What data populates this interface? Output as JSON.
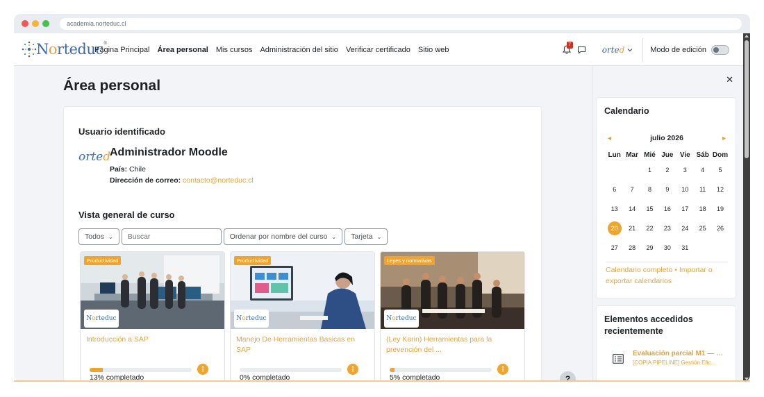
{
  "browser": {
    "url": "academia.norteduc.cl"
  },
  "navbar": {
    "logo_text_pre": "N",
    "logo_text_o": "o",
    "logo_text_post": "rteduc",
    "logo_reg": "®",
    "links": [
      {
        "label": "Página Principal",
        "active": false
      },
      {
        "label": "Área personal",
        "active": true
      },
      {
        "label": "Mis cursos",
        "active": false
      },
      {
        "label": "Administración del sitio",
        "active": false
      },
      {
        "label": "Verificar certificado",
        "active": false
      },
      {
        "label": "Sitio web",
        "active": false
      }
    ],
    "notification_count": "7",
    "user_logo_pre": "orte",
    "user_logo_o": "d",
    "edit_mode_label": "Modo de edición"
  },
  "page": {
    "title": "Área personal"
  },
  "user_block": {
    "heading": "Usuario identificado",
    "avatar_pre": "orte",
    "avatar_o": "d",
    "name": "Administrador Moodle",
    "country_label": "País:",
    "country_value": "Chile",
    "email_label": "Dirección de correo:",
    "email_value": "contacto@norteduc.cl"
  },
  "course_overview": {
    "heading": "Vista general de curso",
    "filter_label": "Todos",
    "search_placeholder": "Buscar",
    "sort_label": "Ordenar por nombre del curso",
    "view_label": "Tarjeta",
    "courses": [
      {
        "category": "Productividad",
        "name": "Introducción a SAP",
        "progress": 13,
        "progress_text": "13% completado"
      },
      {
        "category": "Productividad",
        "name": "Manejo De Herramientas Basicas en SAP",
        "progress": 0,
        "progress_text": "0% completado"
      },
      {
        "category": "Leyes y normativas",
        "name": "(Ley Karin) Herramientas para la prevención del ...",
        "progress": 5,
        "progress_text": "5% completado"
      }
    ],
    "card_logo_pre": "N",
    "card_logo_o": "o",
    "card_logo_post": "rteduc"
  },
  "calendar": {
    "title": "Calendario",
    "month": "julio 2026",
    "prev_arrow": "◄",
    "next_arrow": "►",
    "weekdays": [
      "Lun",
      "Mar",
      "Mié",
      "Jue",
      "Vie",
      "Sáb",
      "Dom"
    ],
    "weeks": [
      [
        "",
        "",
        "1",
        "2",
        "3",
        "4",
        "5"
      ],
      [
        "6",
        "7",
        "8",
        "9",
        "10",
        "11",
        "12"
      ],
      [
        "13",
        "14",
        "15",
        "16",
        "17",
        "18",
        "19"
      ],
      [
        "20",
        "21",
        "22",
        "23",
        "24",
        "25",
        "26"
      ],
      [
        "27",
        "28",
        "29",
        "30",
        "31",
        "",
        ""
      ]
    ],
    "today": "20",
    "links": "Calendario completo • Importar o exportar calendarios"
  },
  "recent": {
    "title": "Elementos accedidos recientemente",
    "item_title": "Evaluación parcial M1 — Á...",
    "item_sub": "[COPIA PIPELINE] Gestión Efic..."
  },
  "help": {
    "label": "?"
  },
  "colors": {
    "accent": "#f0a42b",
    "link": "#e8a33a",
    "brand_blue": "#3d6aa8"
  }
}
